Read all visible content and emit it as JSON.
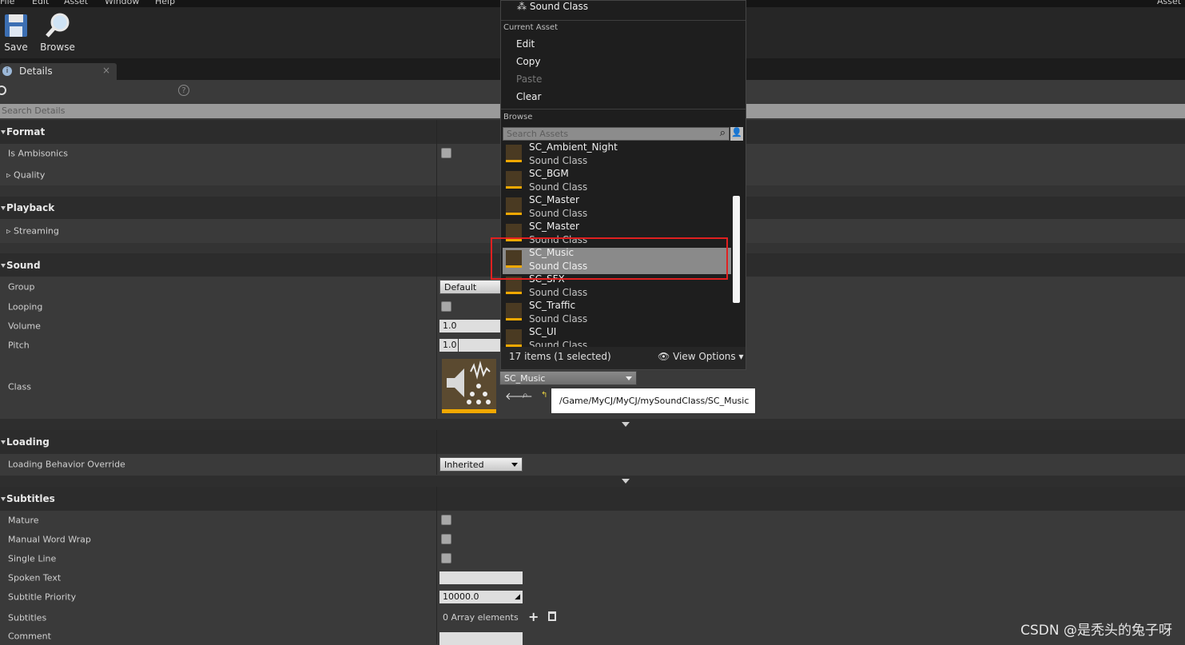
{
  "menu": {
    "file": "File",
    "edit": "Edit",
    "asset": "Asset",
    "window": "Window",
    "help": "Help",
    "right_clip": "Asset"
  },
  "toolbar": {
    "save": "Save",
    "browse": "Browse"
  },
  "tab": {
    "label": "Details"
  },
  "search": {
    "placeholder": "Search Details"
  },
  "categories": {
    "format": "Format",
    "playback": "Playback",
    "sound": "Sound",
    "loading": "Loading",
    "subtitles": "Subtitles"
  },
  "props": {
    "is_ambisonics": "Is Ambisonics",
    "quality": "Quality",
    "streaming": "Streaming",
    "group": "Group",
    "group_value": "Default",
    "looping": "Looping",
    "volume": "Volume",
    "volume_value": "1.0",
    "pitch": "Pitch",
    "pitch_value": "1.0",
    "class": "Class",
    "class_value": "SC_Music",
    "loading_behavior": "Loading Behavior Override",
    "loading_behavior_value": "Inherited",
    "mature": "Mature",
    "manual_word_wrap": "Manual Word Wrap",
    "single_line": "Single Line",
    "spoken_text": "Spoken Text",
    "subtitle_priority": "Subtitle Priority",
    "subtitle_priority_value": "10000.0",
    "subtitles": "Subtitles",
    "array_elements": "0 Array elements",
    "comment": "Comment"
  },
  "popup": {
    "top_item": "Sound Class",
    "current_asset": "Current Asset",
    "edit": "Edit",
    "copy": "Copy",
    "paste": "Paste",
    "clear": "Clear",
    "browse": "Browse",
    "search_placeholder": "Search Assets",
    "assets": [
      {
        "name": "SC_Ambient_Night",
        "type": "Sound Class"
      },
      {
        "name": "SC_BGM",
        "type": "Sound Class"
      },
      {
        "name": "SC_Master",
        "type": "Sound Class"
      },
      {
        "name": "SC_Master",
        "type": "Sound Class"
      },
      {
        "name": "SC_Music",
        "type": "Sound Class",
        "selected": true
      },
      {
        "name": "SC_SFX",
        "type": "Sound Class"
      },
      {
        "name": "SC_Traffic",
        "type": "Sound Class"
      },
      {
        "name": "SC_UI",
        "type": "Sound Class"
      }
    ],
    "count": "17 items (1 selected)",
    "view_options": "View Options"
  },
  "path_tooltip": "/Game/MyCJ/MyCJ/mySoundClass/SC_Music",
  "watermark": "CSDN @是秃头的兔子呀",
  "colors": {
    "highlight_box": "#e02020",
    "selected_row": "#8a8a8a",
    "asset_stripe": "#f0a800"
  }
}
